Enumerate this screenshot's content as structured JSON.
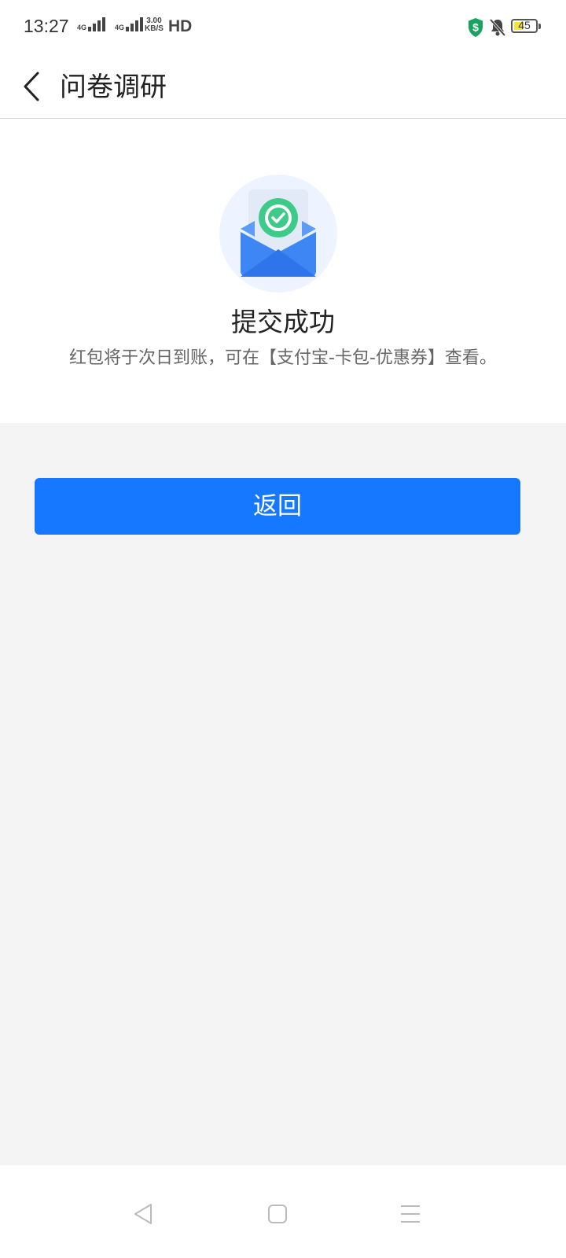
{
  "status_bar": {
    "time": "13:27",
    "signal1_label": "4G",
    "signal2_label": "4G",
    "net_speed_value": "3.00",
    "net_speed_unit": "KB/S",
    "hd_label": "HD",
    "battery_level": "45",
    "shield_color": "#1aa260",
    "battery_fill_color": "#f3e53a"
  },
  "header": {
    "back_icon": "chevron-left-icon",
    "title": "问卷调研"
  },
  "result": {
    "icon": "envelope-check-icon",
    "title": "提交成功",
    "description": "红包将于次日到账，可在【支付宝-卡包-优惠券】查看。"
  },
  "actions": {
    "return_label": "返回",
    "accent_color": "#1677ff"
  },
  "system_nav": {
    "back_icon": "triangle-back-icon",
    "home_icon": "square-home-icon",
    "menu_icon": "menu-lines-icon"
  }
}
